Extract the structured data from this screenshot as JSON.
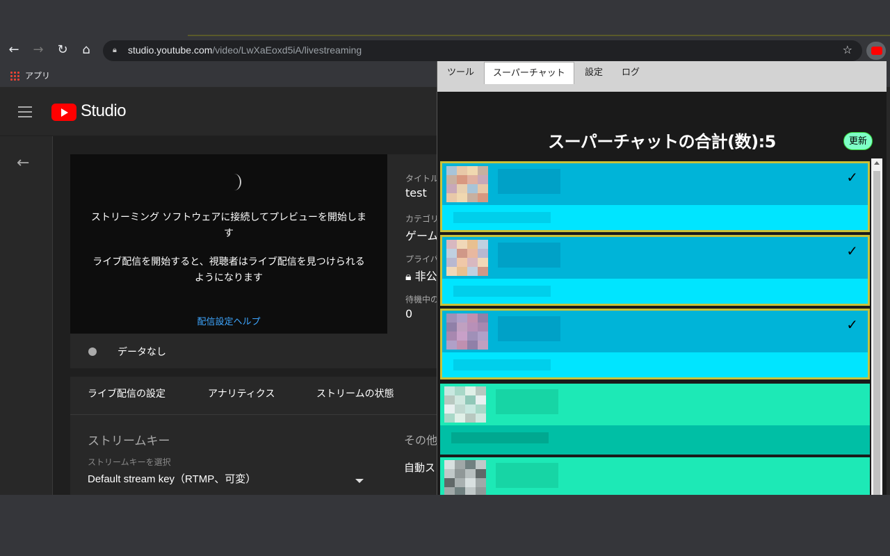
{
  "browser": {
    "url_host": "studio.youtube.com",
    "url_path": "/video/LwXaEoxd5iA/livestreaming",
    "bookmarks_label": "アプリ"
  },
  "studio": {
    "logo_text": "Studio",
    "preview": {
      "message_line1": "ストリーミング ソフトウェアに接続してプレビューを開始します",
      "message_line2": "ライブ配信を開始すると、視聴者はライブ配信を見つけられるようになります",
      "help_link": "配信設定ヘルプ"
    },
    "details": {
      "title_label": "タイトル",
      "title_value": "test",
      "category_label": "カテゴリ",
      "category_value": "ゲーム",
      "privacy_label": "プライバ",
      "privacy_value": "非公",
      "waiting_label": "待機中の",
      "waiting_value": "0"
    },
    "status_text": "データなし",
    "tabs": [
      "ライブ配信の設定",
      "アナリティクス",
      "ストリームの状態"
    ],
    "stream_key": {
      "title": "ストリームキー",
      "caption": "ストリームキーを選択",
      "value": "Default stream key（RTMP、可変）"
    },
    "other": {
      "title": "その他",
      "auto": "自動ス"
    }
  },
  "popup": {
    "tabs": [
      "ツール",
      "スーパーチャット",
      "設定",
      "ログ"
    ],
    "active_tab": "スーパーチャット",
    "title": "スーパーチャットの合計(数):5",
    "refresh_label": "更新",
    "check_symbol": "✓",
    "cards": [
      {
        "theme": "blue",
        "checked": true
      },
      {
        "theme": "blue",
        "checked": true
      },
      {
        "theme": "blue",
        "checked": true
      },
      {
        "theme": "green",
        "checked": false
      },
      {
        "theme": "green",
        "checked": false
      }
    ]
  },
  "colors": {
    "selected_card_border": "#c9c23a",
    "blue_card_top": "#00b4d8",
    "blue_card_bottom": "#00e5ff",
    "green_card_top": "#1de9b6",
    "green_card_bottom": "#00bfa5",
    "refresh_button": "#7effc6",
    "youtube_red": "#ff0000"
  },
  "icons": [
    "back-arrow-icon",
    "forward-arrow-icon",
    "reload-icon",
    "home-icon",
    "lock-icon",
    "star-icon",
    "extension-icon",
    "apps-icon",
    "menu-icon",
    "youtube-logo-icon",
    "back-icon",
    "dropdown-icon",
    "check-icon"
  ]
}
